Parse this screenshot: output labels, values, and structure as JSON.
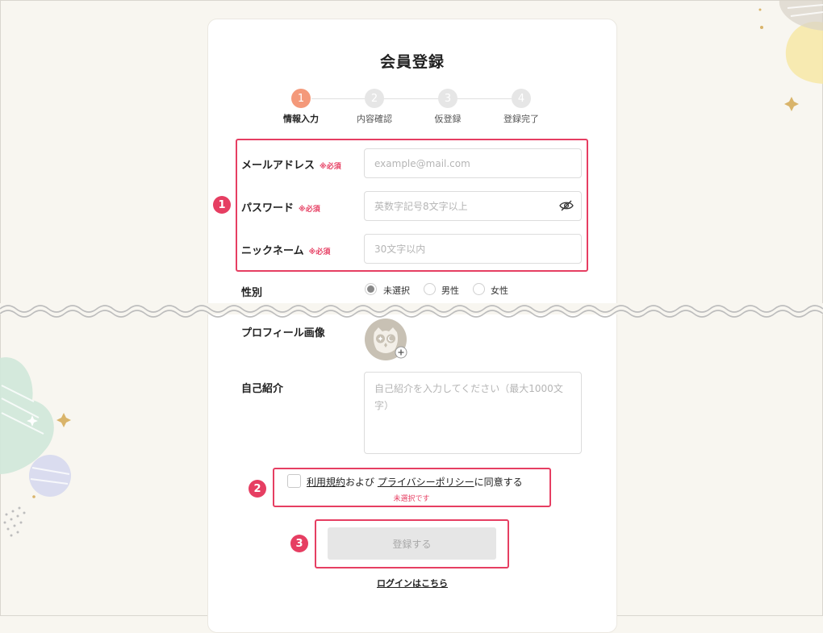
{
  "page": {
    "title": "会員登録"
  },
  "steps": [
    {
      "num": "1",
      "label": "情報入力",
      "active": true
    },
    {
      "num": "2",
      "label": "内容確認",
      "active": false
    },
    {
      "num": "3",
      "label": "仮登録",
      "active": false
    },
    {
      "num": "4",
      "label": "登録完了",
      "active": false
    }
  ],
  "form": {
    "email": {
      "label": "メールアドレス",
      "required": "※必須",
      "placeholder": "example@mail.com",
      "value": ""
    },
    "password": {
      "label": "パスワード",
      "required": "※必須",
      "placeholder": "英数字記号8文字以上",
      "value": "",
      "toggle_icon": "eye-off-icon"
    },
    "nickname": {
      "label": "ニックネーム",
      "required": "※必須",
      "placeholder": "30文字以内",
      "value": ""
    },
    "gender": {
      "label": "性別",
      "options": [
        "未選択",
        "男性",
        "女性"
      ],
      "selected": "未選択"
    },
    "profile_image": {
      "label": "プロフィール画像",
      "icon": "owl-avatar-icon",
      "add_icon": "plus-icon"
    },
    "bio": {
      "label": "自己紹介",
      "placeholder": "自己紹介を入力してください（最大1000文字）",
      "value": ""
    },
    "agree": {
      "terms_link": "利用規約",
      "middle": "および",
      "privacy_link": "プライバシーポリシー",
      "suffix": "に同意する",
      "checked": false,
      "error": "未選択です"
    },
    "submit_label": "登録する",
    "login_link": "ログインはこちら"
  },
  "annotations": [
    "1",
    "2",
    "3"
  ],
  "colors": {
    "accent": "#f4997a",
    "highlight": "#e63e62",
    "background": "#f8f6f0",
    "disabled": "#e6e6e6"
  }
}
